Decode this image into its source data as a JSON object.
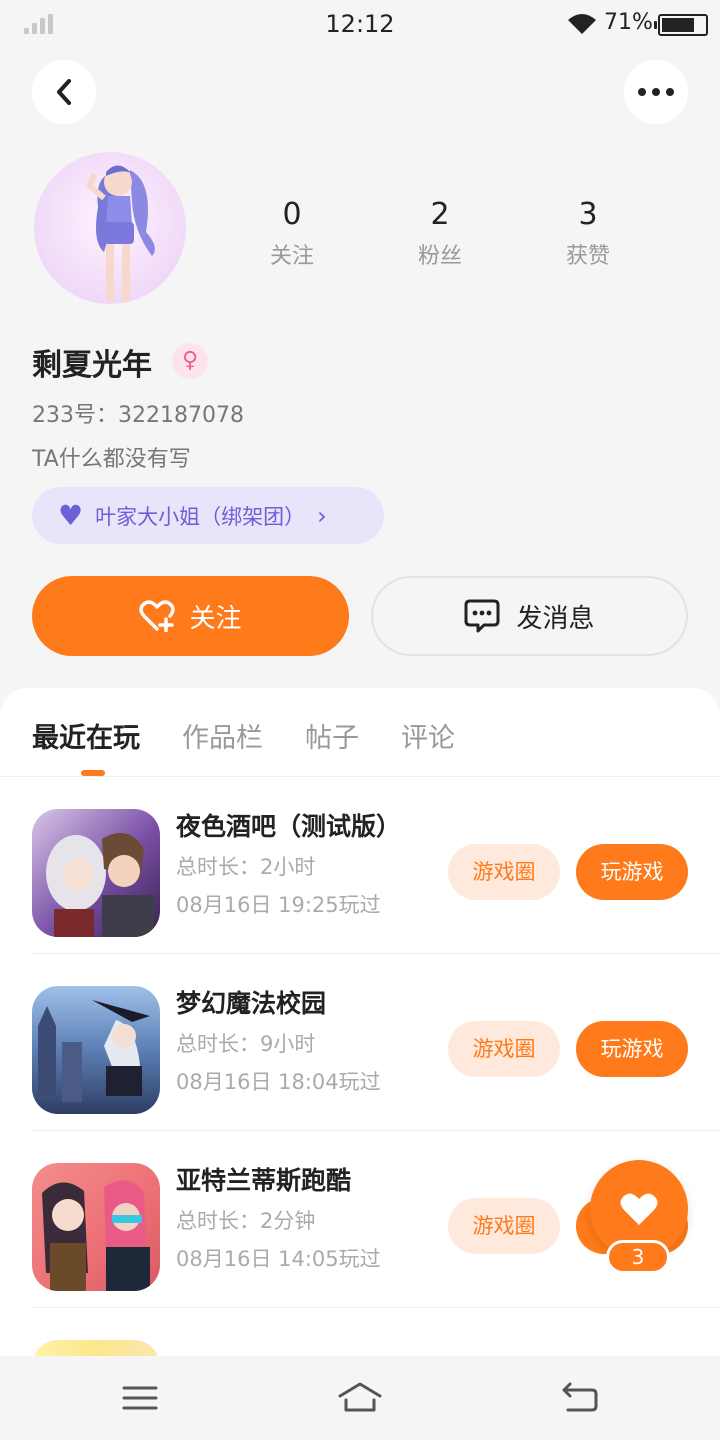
{
  "status_bar": {
    "time": "12:12",
    "battery_percent": "71%"
  },
  "profile": {
    "stats": [
      {
        "value": "0",
        "label": "关注"
      },
      {
        "value": "2",
        "label": "粉丝"
      },
      {
        "value": "3",
        "label": "获赞"
      }
    ],
    "username": "剩夏光年",
    "gender_icon": "female-icon",
    "uid": "233号：322187078",
    "bio": "TA什么都没有写",
    "guild": "叶家大小姐（绑架团）"
  },
  "actions": {
    "follow_label": "关注",
    "message_label": "发消息"
  },
  "tabs": [
    {
      "label": "最近在玩",
      "active": true
    },
    {
      "label": "作品栏",
      "active": false
    },
    {
      "label": "帖子",
      "active": false
    },
    {
      "label": "评论",
      "active": false
    }
  ],
  "games": [
    {
      "name": "夜色酒吧（测试版）",
      "duration": "总时长：2小时",
      "last_played": "08月16日 19:25玩过",
      "circle_label": "游戏圈",
      "play_label": "玩游戏"
    },
    {
      "name": "梦幻魔法校园",
      "duration": "总时长：9小时",
      "last_played": "08月16日 18:04玩过",
      "circle_label": "游戏圈",
      "play_label": "玩游戏"
    },
    {
      "name": "亚特兰蒂斯跑酷",
      "duration": "总时长：2分钟",
      "last_played": "08月16日 14:05玩过",
      "circle_label": "游戏圈",
      "play_label": "玩游戏"
    }
  ],
  "floating_like": {
    "count": "3"
  },
  "colors": {
    "accent": "#ff7a1a",
    "guild": "#6d5fd6",
    "background": "#f5f5f5"
  }
}
